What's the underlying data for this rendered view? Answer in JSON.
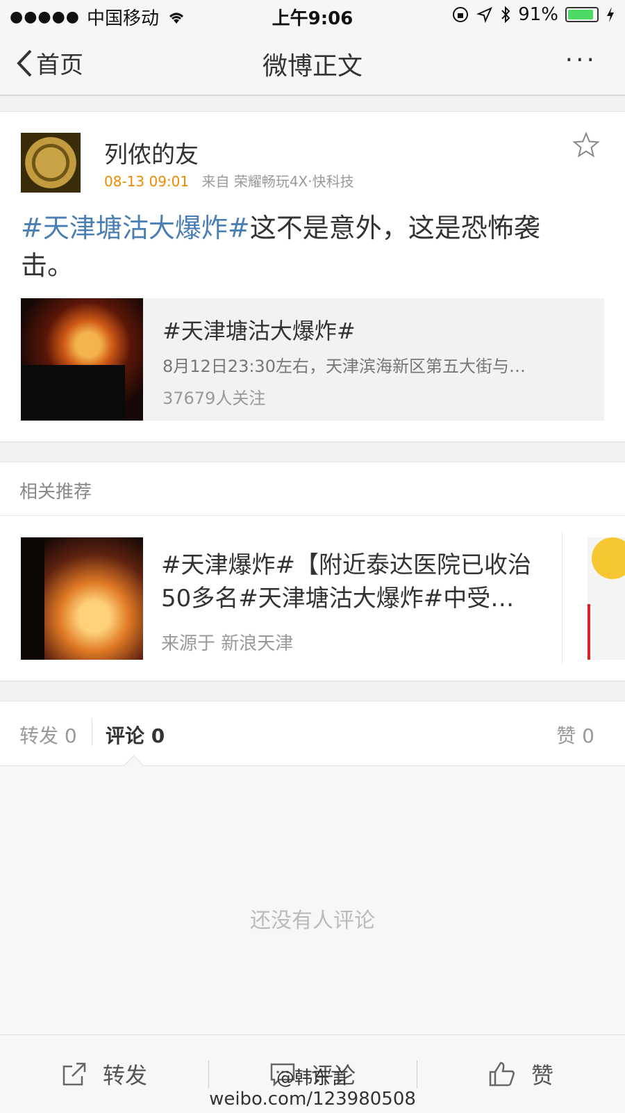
{
  "status_bar": {
    "signal": "●●●●●",
    "carrier": "中国移动",
    "time": "上午9:06",
    "battery_percent": "91%",
    "battery_level": 0.91,
    "battery_color": "#4cd964"
  },
  "nav": {
    "back_label": "首页",
    "title": "微博正文",
    "more_label": "···"
  },
  "post": {
    "username": "列侬的友",
    "time": "08-13 09:01",
    "source": "来自 荣耀畅玩4X·快科技",
    "hashtag": "#天津塘沽大爆炸#",
    "text": "这不是意外，这是恐怖袭击。",
    "topic": {
      "title": "#天津塘沽大爆炸#",
      "description": "8月12日23:30左右，天津滨海新区第五大街与…",
      "followers": "37679人关注"
    }
  },
  "related": {
    "section_title": "相关推荐",
    "items": [
      {
        "text": "#天津爆炸#【附近泰达医院已收治50多名#天津塘沽大爆炸#中受…",
        "source": "来源于 新浪天津"
      }
    ]
  },
  "tabs": {
    "repost": "转发 0",
    "comment": "评论 0",
    "like": "赞 0"
  },
  "comments": {
    "empty_text": "还没有人评论"
  },
  "toolbar": {
    "repost": "转发",
    "comment": "评论",
    "like": "赞"
  },
  "watermark": {
    "line1": "@韩东言",
    "line2": "weibo.com/123980508"
  },
  "colors": {
    "hashtag": "#4a7fb5",
    "time": "#f08a00",
    "background": "#f2f2f2"
  }
}
